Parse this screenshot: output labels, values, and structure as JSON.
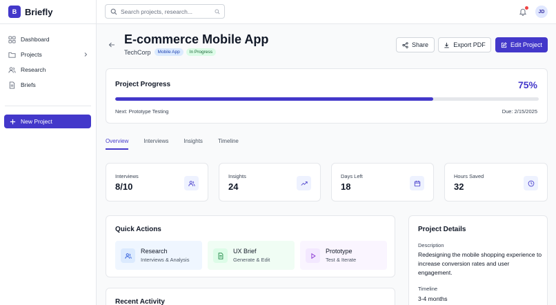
{
  "app": {
    "logo_letter": "B",
    "name": "Briefly"
  },
  "sidebar": {
    "items": [
      {
        "label": "Dashboard",
        "icon": "grid-icon"
      },
      {
        "label": "Projects",
        "icon": "folder-icon"
      },
      {
        "label": "Research",
        "icon": "users-icon"
      },
      {
        "label": "Briefs",
        "icon": "file-icon"
      }
    ],
    "new_project": "New Project"
  },
  "topbar": {
    "search_placeholder": "Search projects, research...",
    "avatar": "JD"
  },
  "project": {
    "title": "E-commerce Mobile App",
    "company": "TechCorp",
    "badges": [
      "Mobile App",
      "In Progress"
    ]
  },
  "actions": {
    "share": "Share",
    "export": "Export PDF",
    "edit": "Edit Project"
  },
  "progress": {
    "title": "Project Progress",
    "percent_label": "75%",
    "percent_value": 0.75,
    "next": "Next: Prototype Testing",
    "due": "Due: 2/15/2025"
  },
  "tabs": [
    "Overview",
    "Interviews",
    "Insights",
    "Timeline"
  ],
  "stats": [
    {
      "label": "Interviews",
      "value": "8/10",
      "icon": "users-icon"
    },
    {
      "label": "Insights",
      "value": "24",
      "icon": "trending-up-icon"
    },
    {
      "label": "Days Left",
      "value": "18",
      "icon": "calendar-icon"
    },
    {
      "label": "Hours Saved",
      "value": "32",
      "icon": "clock-icon"
    }
  ],
  "quick_actions": {
    "title": "Quick Actions",
    "items": [
      {
        "title": "Research",
        "subtitle": "Interviews & Analysis",
        "icon": "users-icon"
      },
      {
        "title": "UX Brief",
        "subtitle": "Generate & Edit",
        "icon": "document-icon"
      },
      {
        "title": "Prototype",
        "subtitle": "Test & Iterate",
        "icon": "play-icon"
      }
    ]
  },
  "recent_activity": {
    "title": "Recent Activity"
  },
  "details": {
    "title": "Project Details",
    "description_label": "Description",
    "description": "Redesigning the mobile shopping experience to increase conversion rates and user engagement.",
    "timeline_label": "Timeline",
    "timeline": "3-4 months"
  },
  "colors": {
    "accent": "#4338ca",
    "notification": "#ef4444"
  }
}
